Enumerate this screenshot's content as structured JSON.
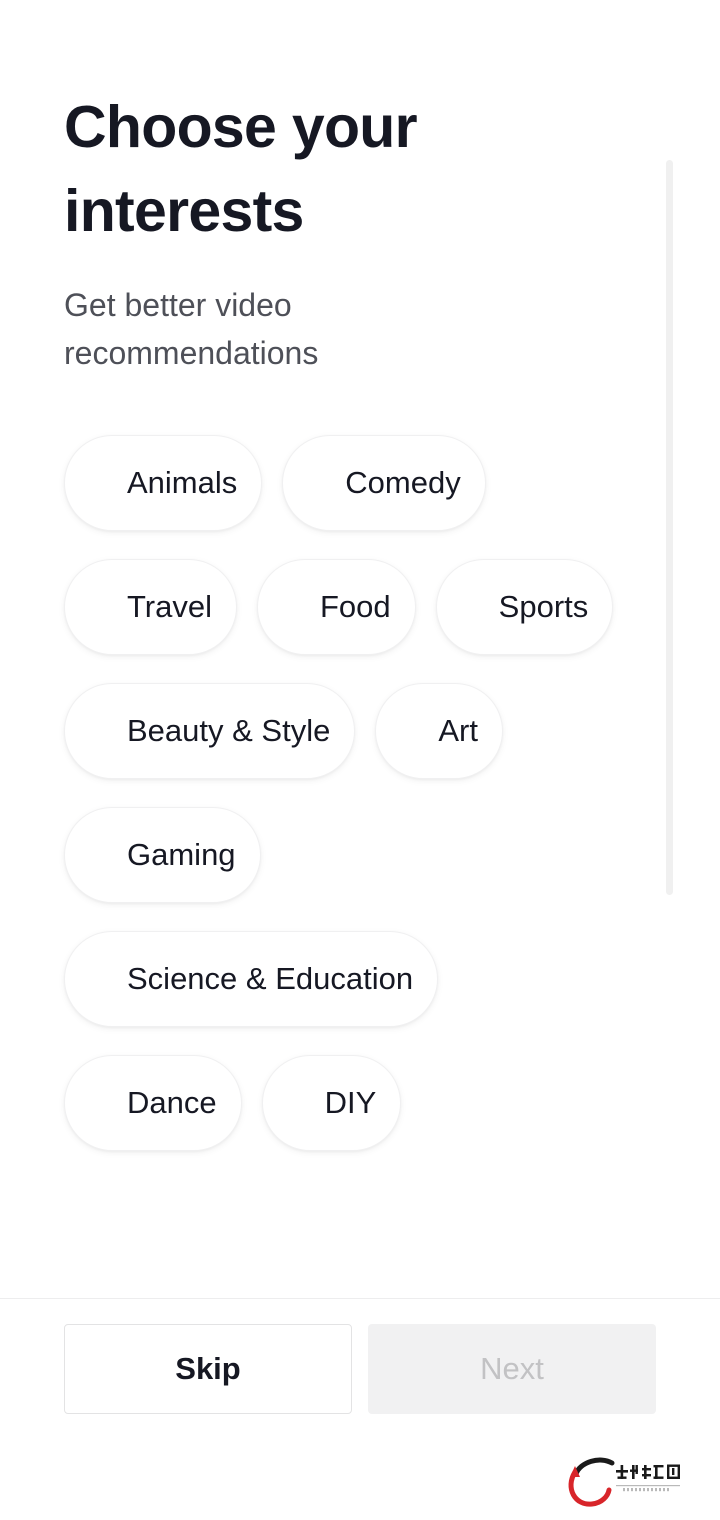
{
  "screen": {
    "title": "Choose your interests",
    "subtitle": "Get better video recommendations"
  },
  "interests": {
    "chips": [
      {
        "label": "Animals",
        "selected": false
      },
      {
        "label": "Comedy",
        "selected": false
      },
      {
        "label": "Travel",
        "selected": false
      },
      {
        "label": "Food",
        "selected": false
      },
      {
        "label": "Sports",
        "selected": false
      },
      {
        "label": "Beauty & Style",
        "selected": false
      },
      {
        "label": "Art",
        "selected": false
      },
      {
        "label": "Gaming",
        "selected": false
      },
      {
        "label": "Science & Education",
        "selected": false
      },
      {
        "label": "Dance",
        "selected": false
      },
      {
        "label": "DIY",
        "selected": false
      }
    ]
  },
  "footer": {
    "skip_label": "Skip",
    "next_label": "Next",
    "next_disabled": true
  },
  "scrollbar": {
    "icon": "vertical-scrollbar-thumb"
  },
  "watermark": {
    "text": "手抖软件园",
    "url_text": "SDHLTW888.COM",
    "icon": "swoosh-logo-icon",
    "accent_color": "#d8252a",
    "dark_color": "#1a1a1a"
  },
  "colors": {
    "text_primary": "#161823",
    "text_secondary": "#4e5058",
    "chip_bg": "#ffffff",
    "chip_border": "#f0f0f1",
    "divider": "#ededee",
    "next_bg": "#f1f1f2",
    "next_text": "#c2c2c4",
    "scrollbar": "#f0f0f0"
  }
}
